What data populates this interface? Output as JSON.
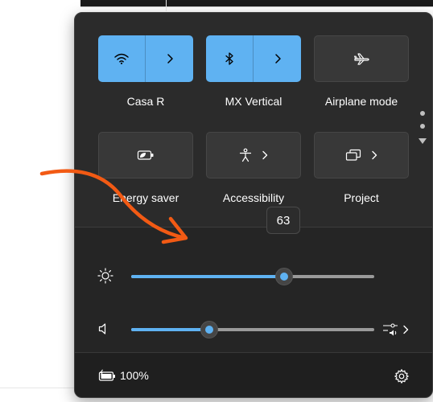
{
  "colors": {
    "accent": "#5fb2f2",
    "panel_bg": "#2b2b2b",
    "tile_off_bg": "#383838",
    "annotation_arrow": "#f25a14"
  },
  "tiles": [
    {
      "label": "Casa R",
      "icon": "wifi-icon",
      "active": true,
      "has_arrow": true
    },
    {
      "label": "MX Vertical",
      "icon": "bluetooth-icon",
      "active": true,
      "has_arrow": true
    },
    {
      "label": "Airplane mode",
      "icon": "airplane-icon",
      "active": false,
      "has_arrow": false
    },
    {
      "label": "Energy saver",
      "icon": "energy-saver-icon",
      "active": false,
      "has_arrow": false
    },
    {
      "label": "Accessibility",
      "icon": "accessibility-icon",
      "active": false,
      "has_arrow": true
    },
    {
      "label": "Project",
      "icon": "project-icon",
      "active": false,
      "has_arrow": true
    }
  ],
  "brightness": {
    "icon": "brightness-icon",
    "value": 63,
    "tooltip": "63"
  },
  "volume": {
    "icon": "speaker-icon",
    "level_percent": 32,
    "output_icon": "audio-output-icon"
  },
  "footer": {
    "battery_icon": "battery-charging-icon",
    "battery_text": "100%",
    "settings_icon": "gear-icon"
  },
  "pager": {
    "pages": 2,
    "current": 1
  }
}
